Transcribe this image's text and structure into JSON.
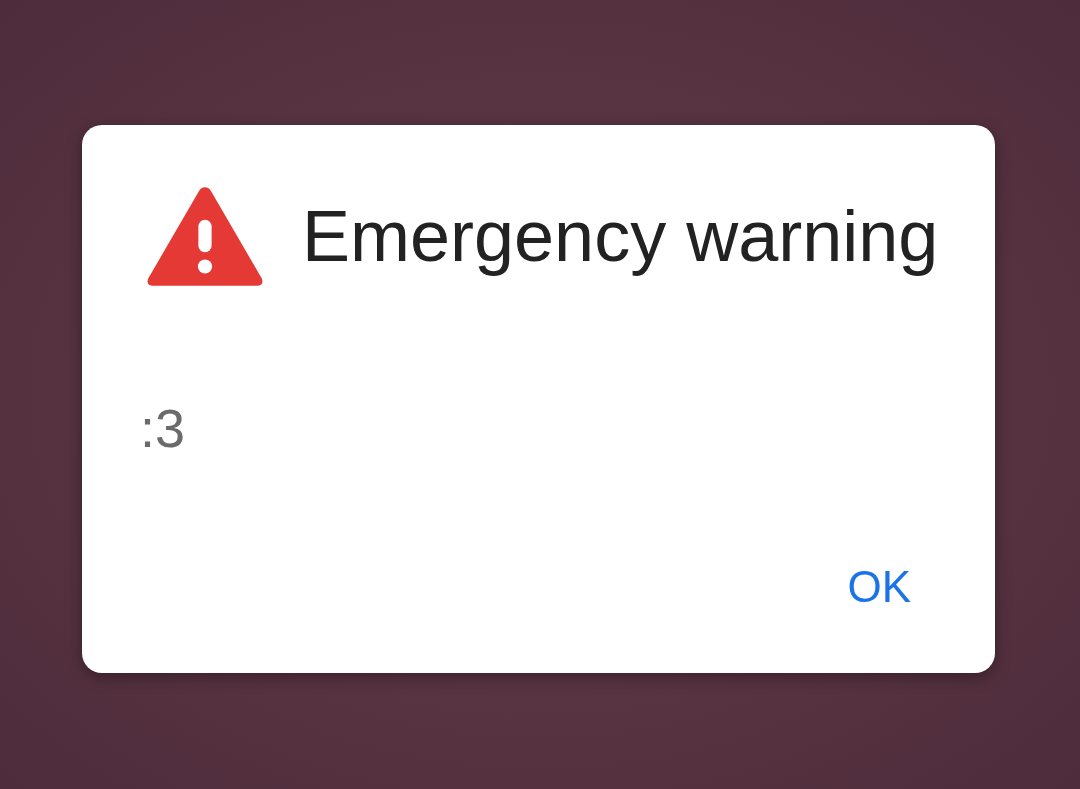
{
  "dialog": {
    "title": "Emergency warning",
    "message": ":3",
    "buttons": [
      "OK"
    ]
  }
}
